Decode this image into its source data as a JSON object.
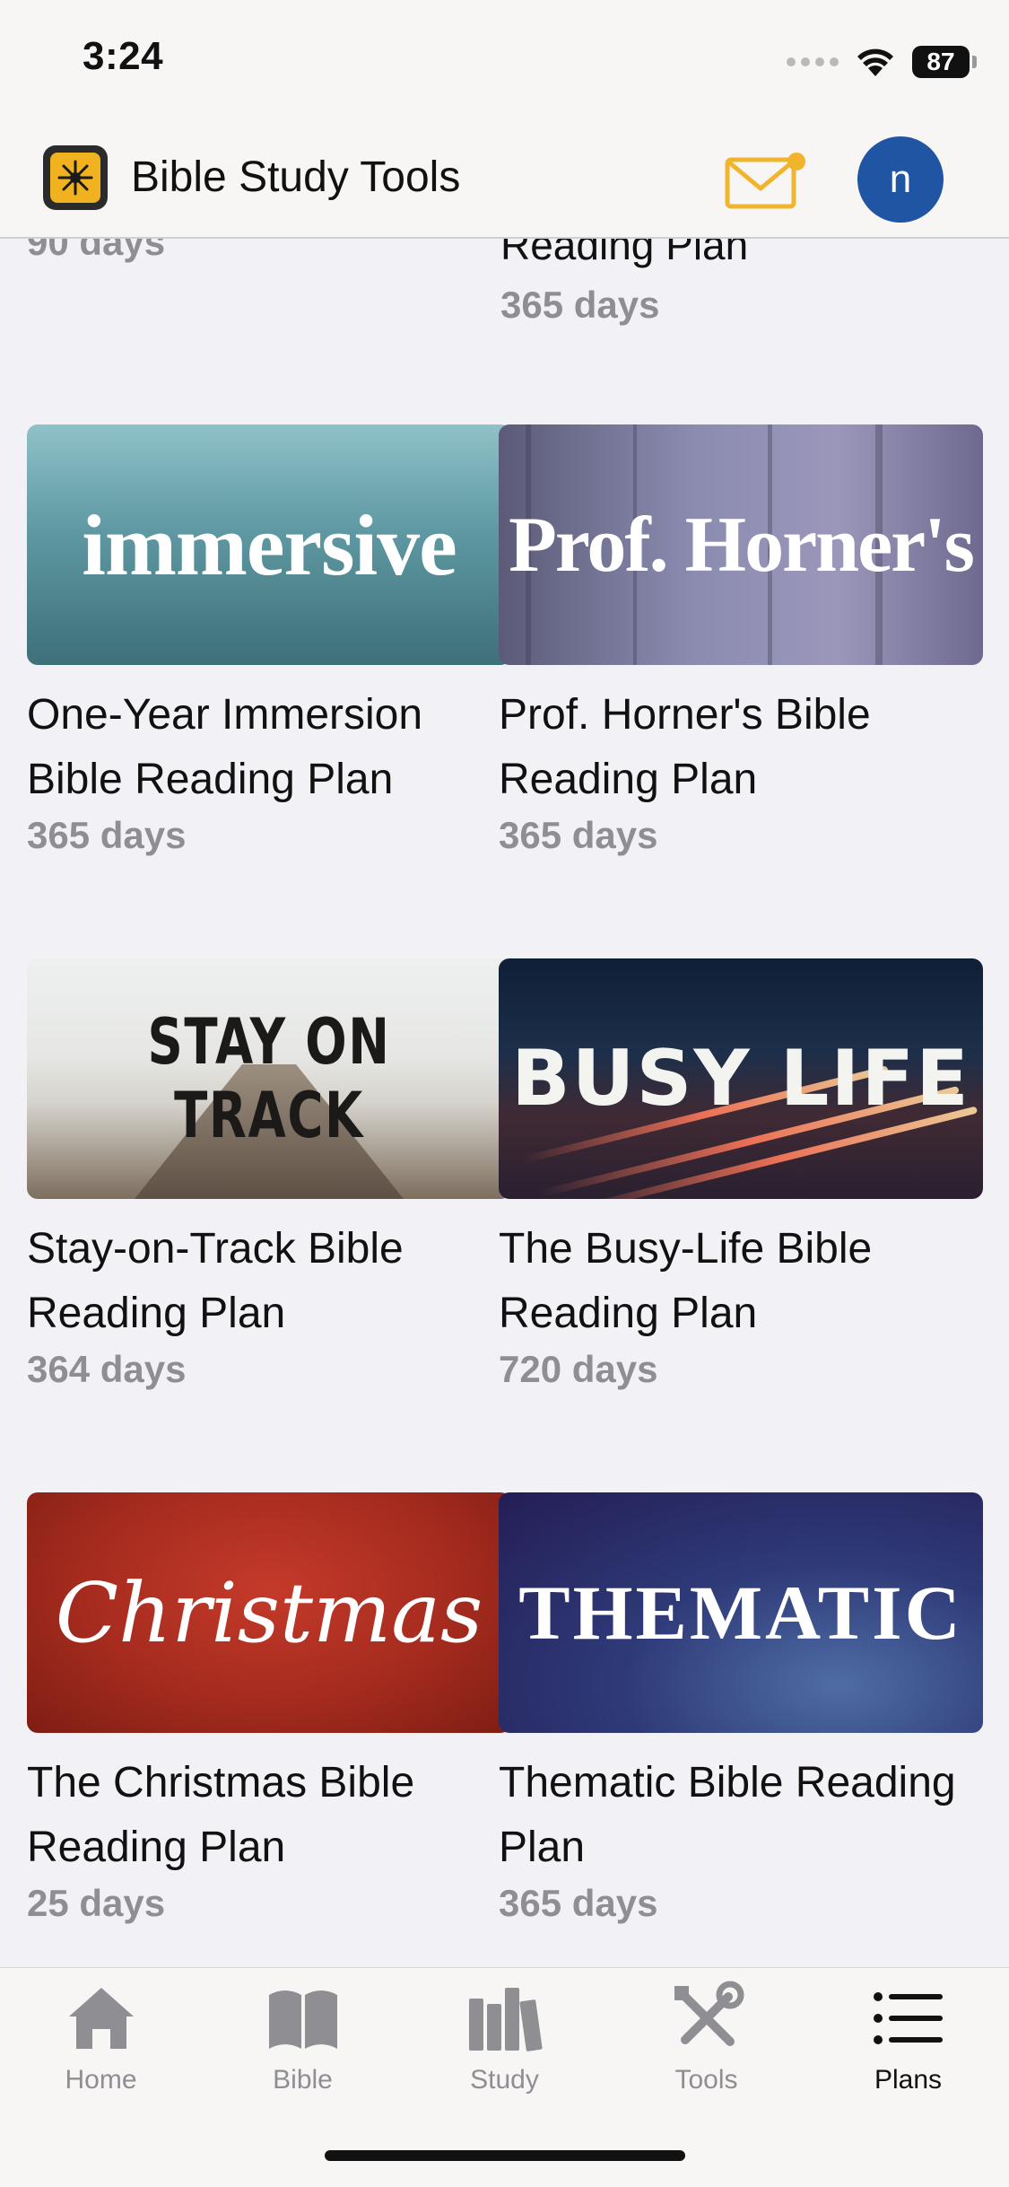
{
  "status_bar": {
    "time": "3:24",
    "battery": "87"
  },
  "header": {
    "title": "Bible Study Tools",
    "avatar_initial": "n"
  },
  "partial_row": {
    "left_days": "90 days",
    "right_title": "Reading Plan",
    "right_days": "365 days"
  },
  "plans": [
    {
      "thumb_text": "immersive",
      "title": "One-Year Immersion Bible Reading Plan",
      "days": "365 days"
    },
    {
      "thumb_text": "Prof. Horner's",
      "title": "Prof. Horner's Bible Reading Plan",
      "days": "365 days"
    },
    {
      "thumb_text": "STAY ON TRACK",
      "title": "Stay-on-Track Bible Reading Plan",
      "days": "364 days"
    },
    {
      "thumb_text": "BUSY LIFE",
      "title": "The Busy-Life Bible Reading Plan",
      "days": "720 days"
    },
    {
      "thumb_text": "Christmas",
      "title": "The Christmas Bible Reading Plan",
      "days": "25 days"
    },
    {
      "thumb_text": "THEMATIC",
      "title": "Thematic Bible Reading Plan",
      "days": "365 days"
    }
  ],
  "tabs": [
    {
      "label": "Home",
      "icon": "home-icon"
    },
    {
      "label": "Bible",
      "icon": "book-icon"
    },
    {
      "label": "Study",
      "icon": "books-icon"
    },
    {
      "label": "Tools",
      "icon": "tools-icon"
    },
    {
      "label": "Plans",
      "icon": "list-icon",
      "active": true
    }
  ],
  "colors": {
    "accent_avatar": "#1f55a3",
    "mail_icon": "#f1b52d",
    "logo": "#f0b21e"
  }
}
